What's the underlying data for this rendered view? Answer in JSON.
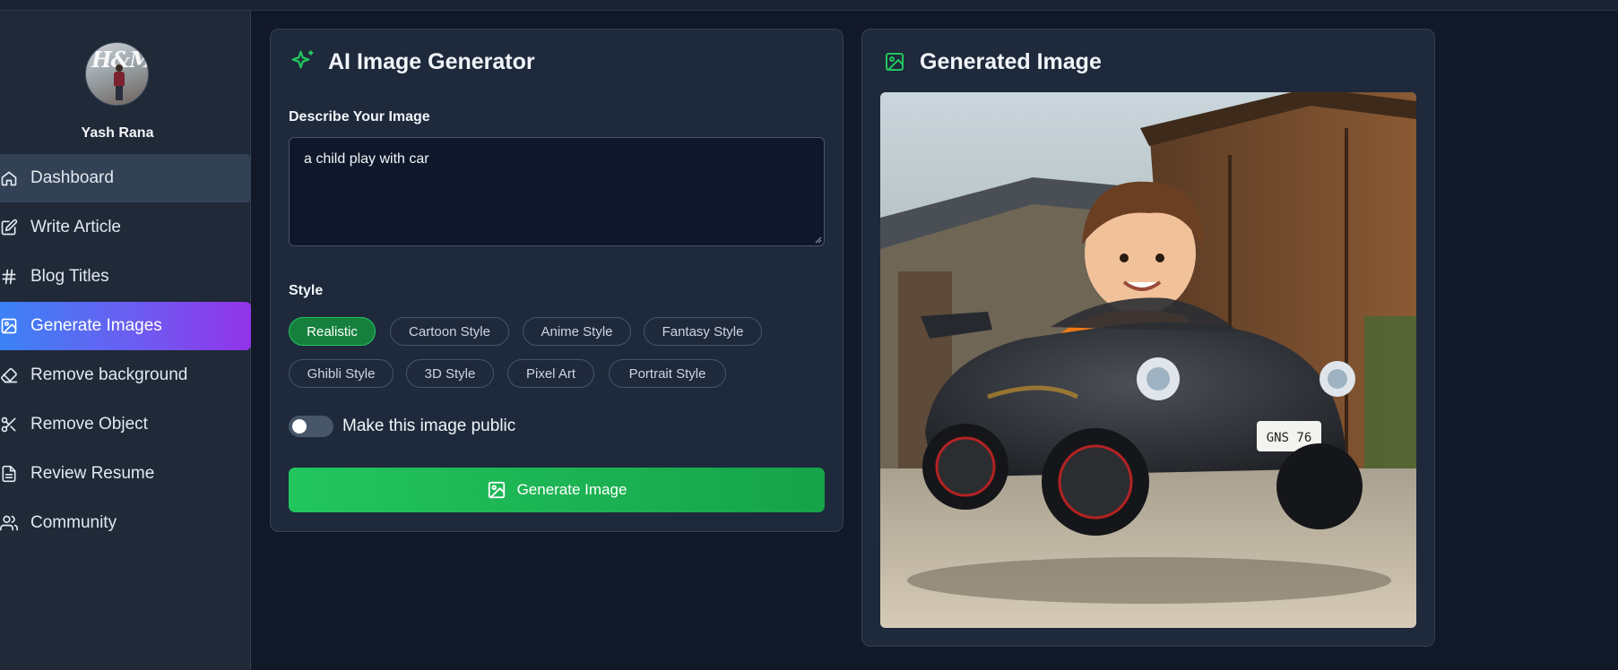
{
  "user": {
    "name": "Yash Rana",
    "avatar_text": "H&M"
  },
  "nav": {
    "items": [
      {
        "label": "Dashboard",
        "icon": "home-icon"
      },
      {
        "label": "Write Article",
        "icon": "edit-icon"
      },
      {
        "label": "Blog Titles",
        "icon": "hash-icon"
      },
      {
        "label": "Generate Images",
        "icon": "image-icon"
      },
      {
        "label": "Remove background",
        "icon": "eraser-icon"
      },
      {
        "label": "Remove Object",
        "icon": "scissors-icon"
      },
      {
        "label": "Review Resume",
        "icon": "file-text-icon"
      },
      {
        "label": "Community",
        "icon": "users-icon"
      }
    ],
    "active": "Generate Images"
  },
  "generator": {
    "title": "AI Image Generator",
    "prompt_label": "Describe Your Image",
    "prompt_value": "a child play with car",
    "style_label": "Style",
    "styles": [
      "Realistic",
      "Cartoon Style",
      "Anime Style",
      "Fantasy Style",
      "Ghibli Style",
      "3D Style",
      "Pixel Art",
      "Portrait Style"
    ],
    "selected_style": "Realistic",
    "public_label": "Make this image public",
    "public_enabled": false,
    "button_label": "Generate Image"
  },
  "result": {
    "title": "Generated Image",
    "plate_text": "GNS 76"
  },
  "colors": {
    "accent_green": "#22c55e",
    "selected_chip": "#15803d",
    "active_nav_gradient_start": "#3b82f6",
    "active_nav_gradient_end": "#9333ea"
  }
}
